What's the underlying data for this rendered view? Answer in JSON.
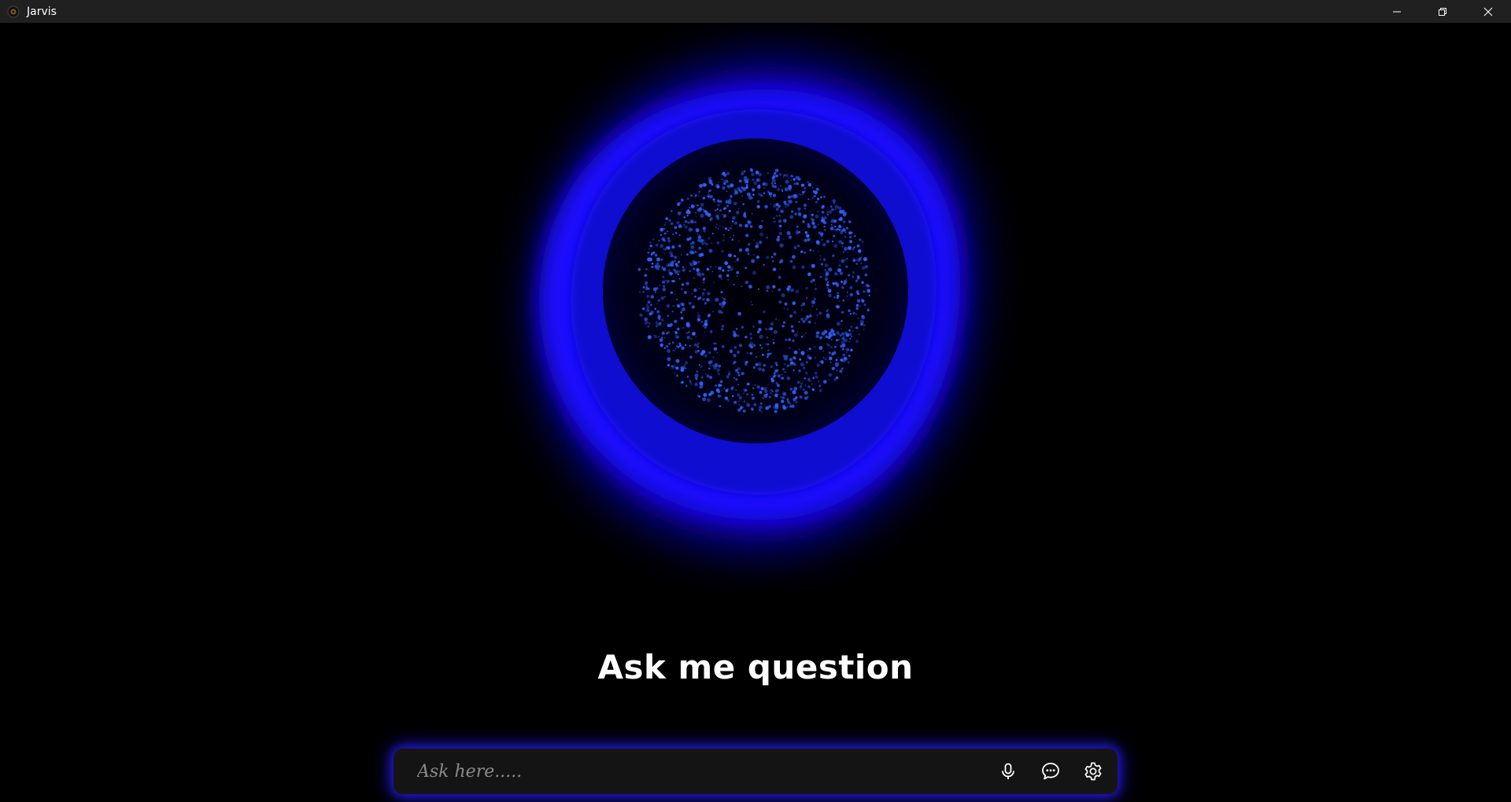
{
  "window": {
    "title": "Jarvis",
    "controls": [
      "minimize",
      "restore",
      "close"
    ]
  },
  "main": {
    "headline": "Ask me question"
  },
  "input_bar": {
    "placeholder": "Ask here.....",
    "value": "",
    "buttons": [
      {
        "icon": "microphone-icon",
        "label": "microphone"
      },
      {
        "icon": "chat-icon",
        "label": "chat"
      },
      {
        "icon": "settings-icon",
        "label": "settings"
      }
    ]
  },
  "colors": {
    "accent": "#1a10ff",
    "glow": "#0000ff",
    "particles": "#2f63ff",
    "background": "#000000",
    "titlebar": "#202020"
  }
}
